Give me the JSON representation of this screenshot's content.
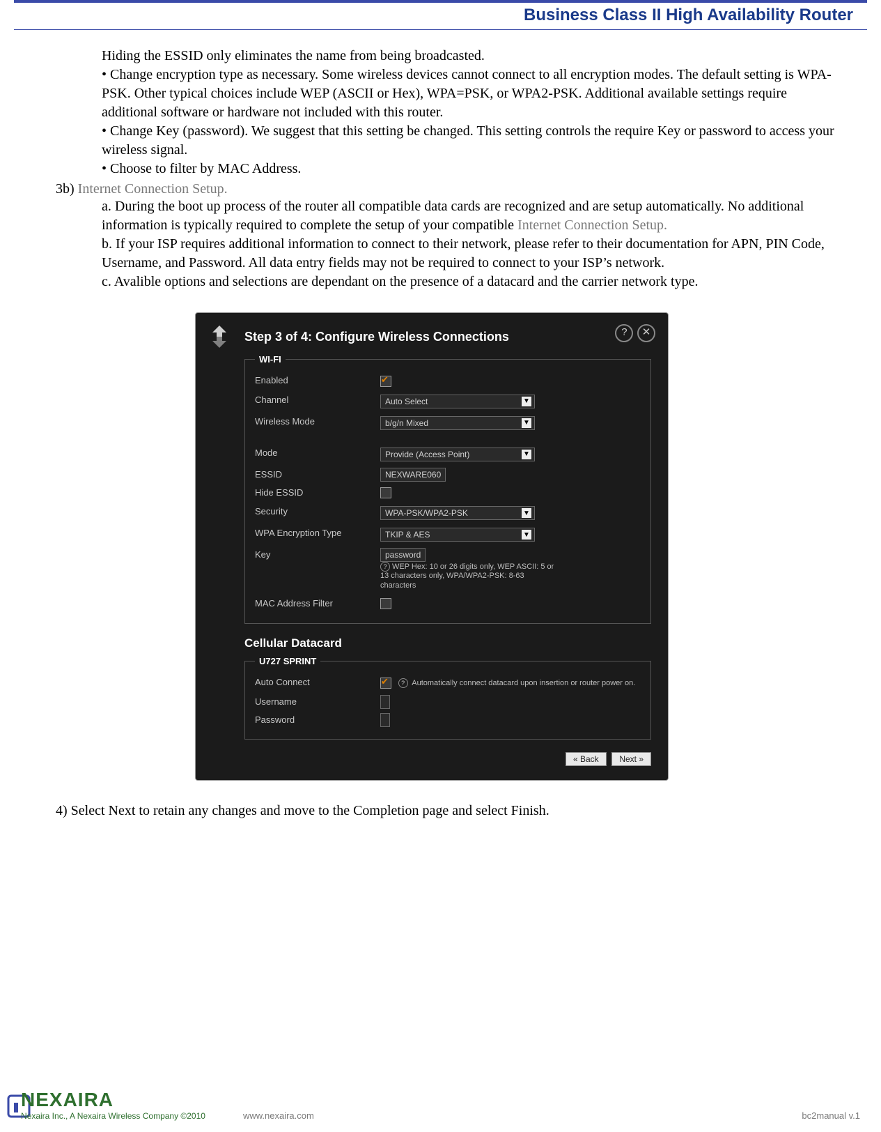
{
  "header": {
    "title": "Business Class II High Availability Router"
  },
  "paragraphs": {
    "p_hide": "Hiding the ESSID only eliminates the name from being broadcasted.",
    "b_enc": "• Change encryption type as necessary. Some wireless devices cannot connect to all encryption modes. The default setting is WPA-PSK. Other typical choices include WEP (ASCII or Hex), WPA=PSK, or WPA2-PSK. Additional available settings require additional software or hardware not included with this router.",
    "b_key": "• Change Key (password). We suggest that this setting be changed. This setting controls the require Key or password to access your wireless signal.",
    "b_mac": "• Choose to filter by MAC Address.",
    "step3b_num": "3b) ",
    "step3b_title": "Internet Connection Setup.",
    "p_a1": "a. During the boot up process of the router all compatible data cards are recognized and are setup automatically. No additional information is typically required to complete the setup of your compatible ",
    "p_a2": "Internet Connection Setup.",
    "p_b": "b. If your ISP requires additional information to connect to their network, please refer to their documentation for APN, PIN Code, Username, and Password. All data entry fields may not be required to connect to your ISP’s network.",
    "p_c": "c. Avalible options and selections are dependant on the presence of a datacard and the carrier network type.",
    "p4": "4) Select Next to retain any changes and move to the Completion page and select Finish."
  },
  "wizard": {
    "title": "Step 3 of 4: Configure Wireless Connections",
    "wifi_legend": "WI-FI",
    "rows": {
      "enabled": {
        "label": "Enabled"
      },
      "channel": {
        "label": "Channel",
        "value": "Auto Select"
      },
      "wmode": {
        "label": "Wireless Mode",
        "value": "b/g/n Mixed"
      },
      "mode": {
        "label": "Mode",
        "value": "Provide (Access Point)"
      },
      "essid": {
        "label": "ESSID",
        "value": "NEXWARE060"
      },
      "hide": {
        "label": "Hide ESSID"
      },
      "security": {
        "label": "Security",
        "value": "WPA-PSK/WPA2-PSK"
      },
      "wpaenc": {
        "label": "WPA Encryption Type",
        "value": "TKIP & AES"
      },
      "key": {
        "label": "Key",
        "value": "password",
        "hint": "WEP Hex: 10 or 26 digits only, WEP ASCII: 5 or 13 characters only, WPA/WPA2-PSK: 8-63 characters"
      },
      "macf": {
        "label": "MAC Address Filter"
      }
    },
    "cell_title": "Cellular Datacard",
    "cell_legend": "U727 SPRINT",
    "cell": {
      "autoconnect": {
        "label": "Auto Connect",
        "hint": "Automatically connect datacard upon insertion or router power on."
      },
      "username": {
        "label": "Username",
        "value": ""
      },
      "password": {
        "label": "Password",
        "value": ""
      }
    },
    "buttons": {
      "back": "« Back",
      "next": "Next »"
    }
  },
  "footer": {
    "brand": "NEXAIRA",
    "tag": "Nexaira Inc., A Nexaira Wireless Company ©2010",
    "url": "www.nexaira.com",
    "ver": "bc2manual v.1"
  }
}
